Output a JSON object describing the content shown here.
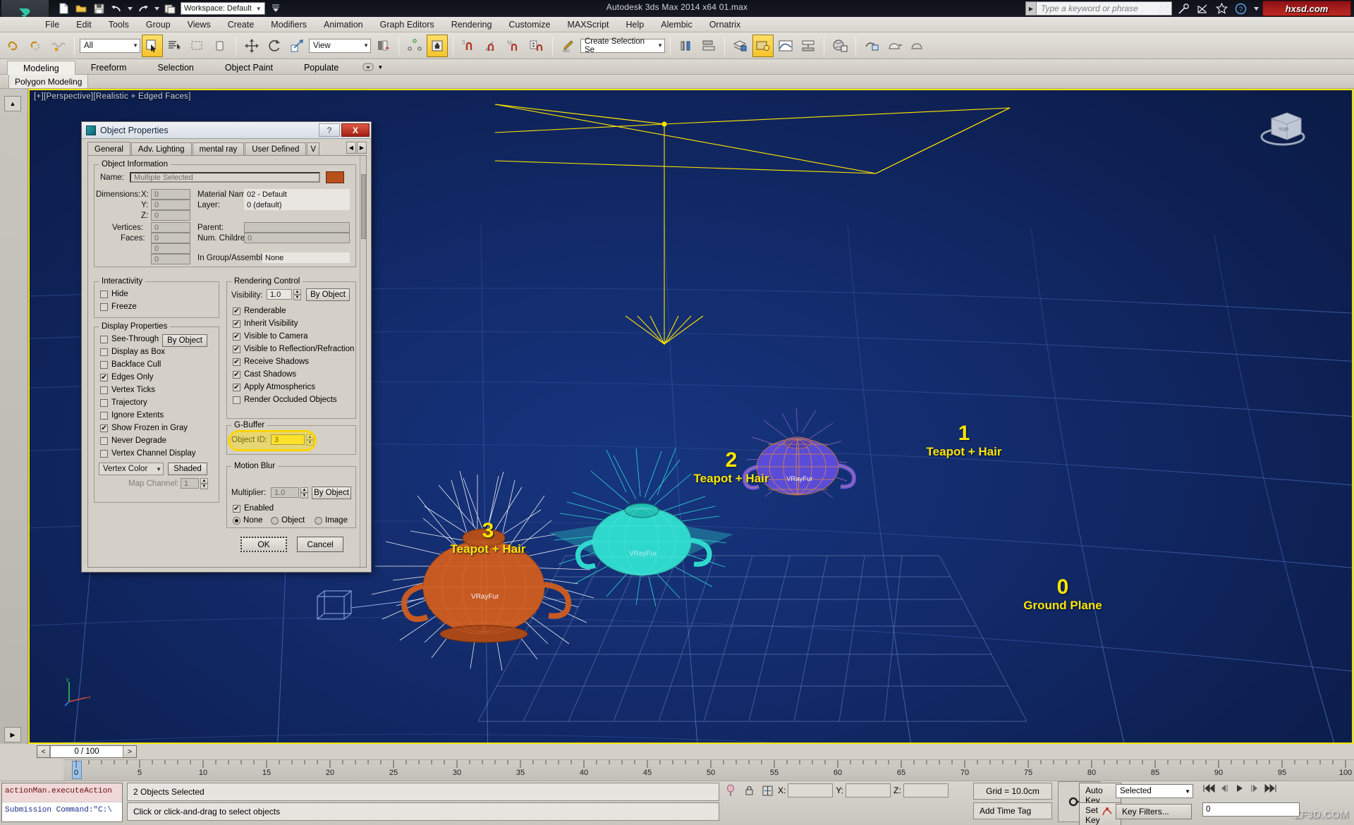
{
  "titlebar": {
    "app_title": "Autodesk 3ds Max  2014 x64     01.max",
    "workspace": "Workspace: Default",
    "search_placeholder": "Type a keyword or phrase",
    "brand": "hxsd.com",
    "quick_access": [
      "new-file-icon",
      "open-file-icon",
      "save-file-icon",
      "undo-icon",
      "redo-icon",
      "project-folder-icon"
    ],
    "right_icons": [
      "binoculars-icon",
      "key-search-icon",
      "satellite-icon",
      "star-icon",
      "help-circle-icon"
    ]
  },
  "menubar": {
    "items": [
      "File",
      "Edit",
      "Tools",
      "Group",
      "Views",
      "Create",
      "Modifiers",
      "Animation",
      "Graph Editors",
      "Rendering",
      "Customize",
      "MAXScript",
      "Help",
      "Alembic",
      "Ornatrix"
    ]
  },
  "maintoolbar": {
    "selection_filter": "All",
    "reference_coord": "View",
    "selection_set": "Create Selection Se",
    "selection_set_placeholder": "Create Selection Set"
  },
  "ribbon": {
    "tabs": [
      "Modeling",
      "Freeform",
      "Selection",
      "Object Paint",
      "Populate"
    ],
    "selected_tab": "Modeling",
    "panel_label": "Polygon Modeling"
  },
  "viewport": {
    "label": "[+][Perspective][Realistic + Edged Faces]",
    "annotations": [
      {
        "num": "3",
        "name": "Teapot + Hair"
      },
      {
        "num": "2",
        "name": "Teapot + Hair"
      },
      {
        "num": "1",
        "name": "Teapot + Hair"
      },
      {
        "num": "0",
        "name": "Ground Plane"
      }
    ],
    "object_tags": [
      "VRayFur",
      "VRayFur",
      "VRayFur"
    ],
    "viewcube_face": "TOP"
  },
  "dialog": {
    "title": "Object Properties",
    "help_label": "?",
    "close_label": "X",
    "tabs": [
      "General",
      "Adv. Lighting",
      "mental ray",
      "User Defined",
      "V"
    ],
    "selected_tab": "General",
    "nav_prev": "◀",
    "nav_next": "▶",
    "object_information": {
      "legend": "Object Information",
      "name_label": "Name:",
      "name_value": "Multiple Selected",
      "dimensions_label": "Dimensions:",
      "x_label": "X:",
      "x_value": "0",
      "y_label": "Y:",
      "y_value": "0",
      "z_label": "Z:",
      "z_value": "0",
      "vertices_label": "Vertices:",
      "vertices_value": "0",
      "faces_label": "Faces:",
      "faces_value": "0",
      "extra1_value": "0",
      "extra2_value": "0",
      "material_name_label": "Material Name:",
      "material_name_value": "02 - Default",
      "layer_label": "Layer:",
      "layer_value": "0 (default)",
      "parent_label": "Parent:",
      "parent_value": "",
      "num_children_label": "Num. Children:",
      "num_children_value": "0",
      "in_group_label": "In Group/Assembly:",
      "in_group_value": "None",
      "color_swatch": "#b8501c"
    },
    "interactivity": {
      "legend": "Interactivity",
      "items": [
        {
          "label": "Hide",
          "checked": false
        },
        {
          "label": "Freeze",
          "checked": false
        }
      ]
    },
    "display_properties": {
      "legend": "Display Properties",
      "by_object_label": "By Object",
      "items": [
        {
          "label": "See-Through",
          "checked": false
        },
        {
          "label": "Display as Box",
          "checked": false
        },
        {
          "label": "Backface Cull",
          "checked": false
        },
        {
          "label": "Edges Only",
          "checked": true
        },
        {
          "label": "Vertex Ticks",
          "checked": false
        },
        {
          "label": "Trajectory",
          "checked": false
        },
        {
          "label": "Ignore Extents",
          "checked": false
        },
        {
          "label": "Show Frozen in Gray",
          "checked": true
        },
        {
          "label": "Never Degrade",
          "checked": false
        },
        {
          "label": "Vertex Channel Display",
          "checked": false
        }
      ],
      "vertex_color_select": "Vertex Color",
      "shaded_label": "Shaded",
      "map_channel_label": "Map Channel:",
      "map_channel_value": "1"
    },
    "rendering_control": {
      "legend": "Rendering Control",
      "visibility_label": "Visibility:",
      "visibility_value": "1.0",
      "by_object_label": "By Object",
      "items": [
        {
          "label": "Renderable",
          "checked": true
        },
        {
          "label": "Inherit Visibility",
          "checked": true
        },
        {
          "label": "Visible to Camera",
          "checked": true
        },
        {
          "label": "Visible to Reflection/Refraction",
          "checked": true
        },
        {
          "label": "Receive Shadows",
          "checked": true
        },
        {
          "label": "Cast Shadows",
          "checked": true
        },
        {
          "label": "Apply Atmospherics",
          "checked": true
        },
        {
          "label": "Render Occluded Objects",
          "checked": false
        }
      ]
    },
    "gbuffer": {
      "legend": "G-Buffer",
      "object_id_label": "Object ID:",
      "object_id_value": "3",
      "highlight_color": "#ffd400"
    },
    "motion_blur": {
      "legend": "Motion Blur",
      "multiplier_label": "Multiplier:",
      "multiplier_value": "1.0",
      "by_object_label": "By Object",
      "enabled_label": "Enabled",
      "enabled_checked": true,
      "modes": [
        {
          "label": "None",
          "selected": true
        },
        {
          "label": "Object",
          "selected": false
        },
        {
          "label": "Image",
          "selected": false
        }
      ]
    },
    "ok_label": "OK",
    "cancel_label": "Cancel"
  },
  "timeline": {
    "prev_label": "<",
    "next_label": ">",
    "frame_value": "0 / 100",
    "ticks": [
      0,
      5,
      10,
      15,
      20,
      25,
      30,
      35,
      40,
      45,
      50,
      55,
      60,
      65,
      70,
      75,
      80,
      85,
      90,
      95,
      100
    ]
  },
  "statusbar": {
    "maxscript_line1": "actionMan.executeAction",
    "maxscript_line2": "Submission Command:\"C:\\",
    "selection_status": "2 Objects Selected",
    "prompt": "Click or click-and-drag to select objects",
    "x_label": "X:",
    "x_value": "",
    "y_label": "Y:",
    "y_value": "",
    "z_label": "Z:",
    "z_value": "",
    "grid": "Grid = 10.0cm",
    "add_time_tag": "Add Time Tag",
    "auto_key": "Auto Key",
    "set_key": "Set Key",
    "key_mode": "Selected",
    "key_filters": "Key Filters...",
    "key_spinner_value": "0"
  }
}
